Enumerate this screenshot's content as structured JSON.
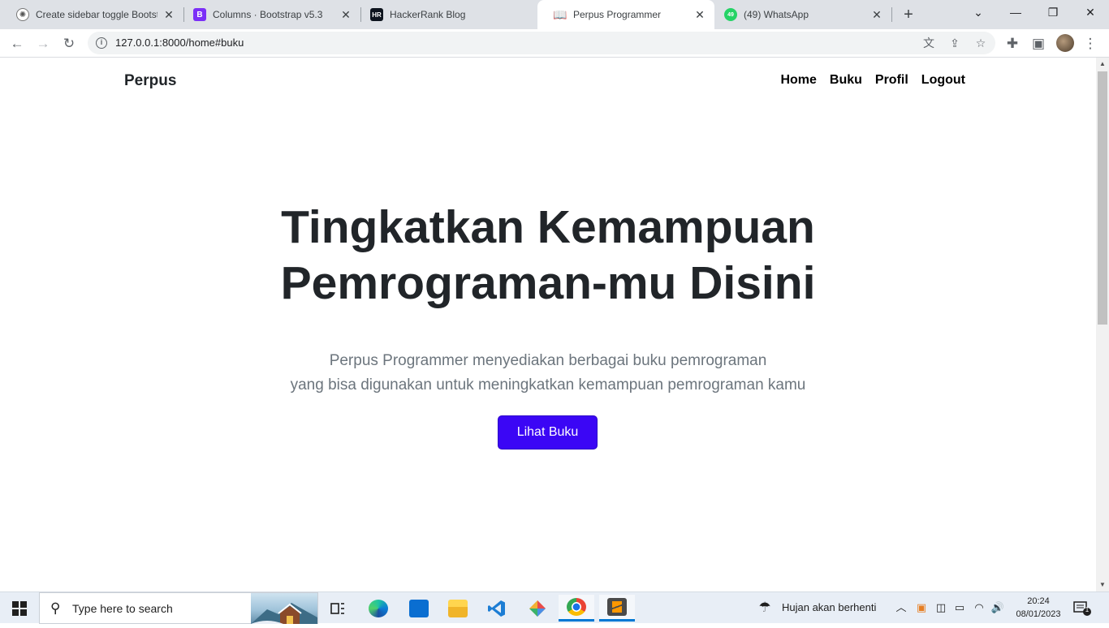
{
  "browser": {
    "tabs": [
      {
        "title": "Create sidebar toggle Bootstr",
        "favicon": "chatgpt-icon"
      },
      {
        "title": "Columns · Bootstrap v5.3",
        "favicon": "bootstrap-icon"
      },
      {
        "title": "HackerRank Blog",
        "favicon": "hackerrank-icon"
      },
      {
        "title": "Perpus Programmer",
        "favicon": "book-icon"
      },
      {
        "title": "(49) WhatsApp",
        "favicon": "whatsapp-icon"
      }
    ],
    "whatsapp_badge": "49",
    "url": "127.0.0.1:8000/home#buku"
  },
  "page": {
    "brand": "Perpus",
    "nav": [
      "Home",
      "Buku",
      "Profil",
      "Logout"
    ],
    "hero_title_line1": "Tingkatkan Kemampuan",
    "hero_title_line2": "Pemrograman-mu Disini",
    "hero_sub_line1": "Perpus Programmer menyediakan berbagai buku pemrograman",
    "hero_sub_line2": "yang bisa digunakan untuk meningkatkan kemampuan pemrograman kamu",
    "cta_label": "Lihat Buku",
    "accent_color": "#3b06f5"
  },
  "taskbar": {
    "search_placeholder": "Type here to search",
    "weather_text": "Hujan akan berhenti",
    "time": "20:24",
    "date": "08/01/2023",
    "notification_count": "1"
  }
}
